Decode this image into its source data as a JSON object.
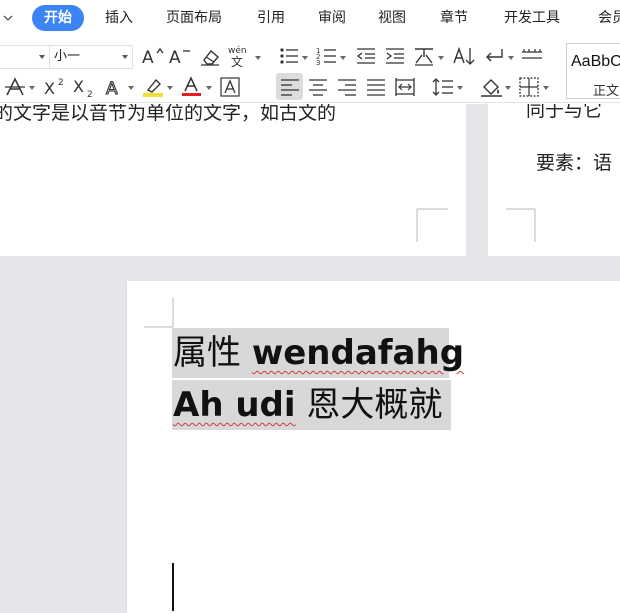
{
  "menu": {
    "tabs": [
      {
        "label": "开始",
        "active": true
      },
      {
        "label": "插入"
      },
      {
        "label": "页面布局"
      },
      {
        "label": "引用"
      },
      {
        "label": "审阅"
      },
      {
        "label": "视图"
      },
      {
        "label": "章节"
      },
      {
        "label": "开发工具"
      },
      {
        "label": "会员"
      }
    ]
  },
  "ribbon": {
    "font_size_select": "小一",
    "phonetic_glyph": "wén",
    "style_gallery": {
      "preview": "AaBbCc",
      "name": "正文"
    },
    "icons": {
      "row1": [
        "font-grow-icon",
        "font-shrink-icon",
        "clear-format-icon",
        "phonetic-guide-icon",
        "bullet-list-icon",
        "numbered-list-icon",
        "decrease-indent-icon",
        "increase-indent-icon",
        "chinese-layout-icon",
        "sort-icon",
        "show-marks-icon",
        "table-grid-icon"
      ],
      "row2": [
        "strikethrough-icon",
        "superscript-icon",
        "subscript-icon",
        "text-effect-icon",
        "highlight-icon",
        "font-color-icon",
        "char-border-icon",
        "align-left-icon",
        "align-center-icon",
        "align-right-icon",
        "justify-icon",
        "distributed-icon",
        "line-spacing-icon",
        "shading-icon",
        "border-icon"
      ]
    },
    "colors": {
      "accent": "#3c84f4",
      "highlight": "#f2e130",
      "font_color": "#e02020"
    }
  },
  "document": {
    "top_left_text": "的文字是以音节为单位的文字，如古文的",
    "top_right_text_1": "同于与它",
    "top_right_text_2": "要素：语",
    "line1": {
      "cjk": "属性",
      "latin": "wendafahg"
    },
    "line2": {
      "latin": "Ah udi",
      "cjk": "恩大概就"
    }
  }
}
